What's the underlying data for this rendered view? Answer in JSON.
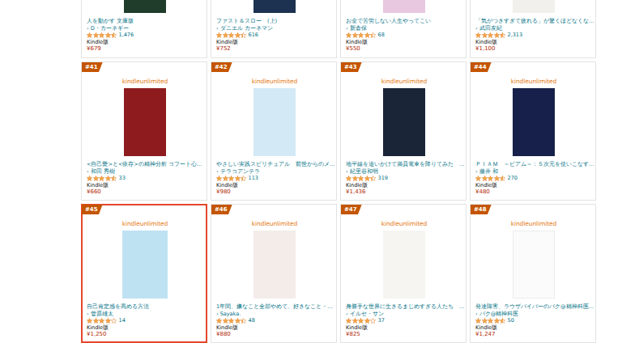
{
  "program_logo": "kindleunlimited",
  "top_row": [
    {
      "title": "人を動かす 文庫版",
      "author": "› D・カーネギー",
      "stars": 4.5,
      "count": "1,476",
      "format": "Kindle版",
      "price": "¥679"
    },
    {
      "title": "ファスト＆スロー　(上)",
      "author": "› ダニエル カーネマン",
      "stars": 4.5,
      "count": "616",
      "format": "Kindle版",
      "price": "¥752"
    },
    {
      "title": "お金で苦労しない人生やってこい",
      "author": "› 新倉保",
      "stars": 4.5,
      "count": "68",
      "format": "Kindle版",
      "price": "¥550"
    },
    {
      "title": "「気がつきすぎて疲れる」が驚くほどなくな…",
      "author": "› 武田友紀",
      "stars": 4.5,
      "count": "2,313",
      "format": "Kindle版",
      "price": "¥1,100"
    }
  ],
  "ranking": [
    {
      "rank": "#41",
      "title": "<自己愛>と<依存>の精神分析 コフート心…",
      "author": "› 和田 秀樹",
      "stars": 4.5,
      "count": "33",
      "format": "Kindle版",
      "price": "¥660",
      "selected": false
    },
    {
      "rank": "#42",
      "title": "やさしい実践スピリチュアル　前世からのメ…",
      "author": "› テラコアンテラ",
      "stars": 4.5,
      "count": "113",
      "format": "Kindle版",
      "price": "¥980",
      "selected": false
    },
    {
      "rank": "#43",
      "title": "地平線を追いかけて満員電車を降りてみた　…",
      "author": "› 紀里谷和明",
      "stars": 4.5,
      "count": "319",
      "format": "Kindle版",
      "price": "¥1,436",
      "selected": false
    },
    {
      "rank": "#44",
      "title": "ＰＩＡＭ　～ピアム～：５次元を使いこなす…",
      "author": "› 藤井 和",
      "stars": 4.5,
      "count": "270",
      "format": "Kindle版",
      "price": "¥480",
      "selected": false
    },
    {
      "rank": "#45",
      "title": "自己肯定感を高める方法",
      "author": "› 菅原雄太",
      "stars": 4,
      "count": "14",
      "format": "Kindle版",
      "price": "¥1,250",
      "selected": true
    },
    {
      "rank": "#46",
      "title": "1年間、嫌なこと全部やめて、好きなこと・…",
      "author": "› Sayaka.",
      "stars": 4.5,
      "count": "48",
      "format": "Kindle版",
      "price": "¥880",
      "selected": false
    },
    {
      "rank": "#47",
      "title": "身勝手な世界に生きるまじめすぎる人たち　…",
      "author": "› イルセ・サン",
      "stars": 4,
      "count": "37",
      "format": "Kindle版",
      "price": "¥825",
      "selected": false
    },
    {
      "rank": "#48",
      "title": "発達障害、ラウザパイパーのバク@精神科医…",
      "author": "› バク@精神科医",
      "stars": 4.5,
      "count": "50",
      "format": "Kindle版",
      "price": "¥1,247",
      "selected": false
    }
  ]
}
